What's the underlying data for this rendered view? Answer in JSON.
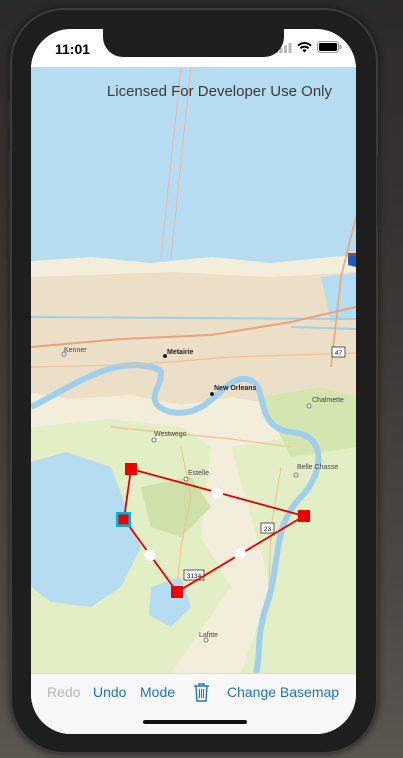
{
  "status_bar": {
    "time": "11:01"
  },
  "map": {
    "license_text": "Licensed For Developer Use Only",
    "places": {
      "kenner": "Kenner",
      "metairie": "Metairie",
      "new_orleans": "New Orleans",
      "chalmette": "Chalmette",
      "westwego": "Westwego",
      "estelle": "Estelle",
      "belle_chasse": "Belle Chasse",
      "lafitte": "Lafitte"
    },
    "shields": {
      "hwy_47": "47",
      "hwy_23": "23",
      "hwy_3134": "3134"
    }
  },
  "toolbar": {
    "redo": "Redo",
    "undo": "Undo",
    "mode": "Mode",
    "change_basemap": "Change Basemap"
  }
}
